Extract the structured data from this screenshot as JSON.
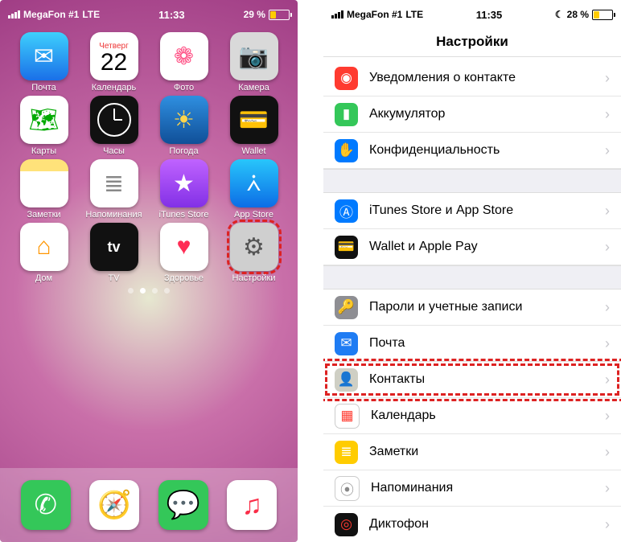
{
  "left": {
    "status": {
      "carrier": "MegaFon #1",
      "net": "LTE",
      "time": "11:33",
      "battery": "29 %",
      "battery_pct": 29,
      "fill": "#ffcc00"
    },
    "apps": [
      [
        {
          "n": "mail",
          "label": "Почта",
          "bg": "linear-gradient(#3ed0fd,#1a6fe8)",
          "glyph": "✉︎",
          "gc": "#fff"
        },
        {
          "n": "calendar",
          "label": "Календарь",
          "day": "Четверг",
          "date": "22"
        },
        {
          "n": "photos",
          "label": "Фото",
          "bg": "#fff",
          "glyph": "❁",
          "gc": "#f58"
        },
        {
          "n": "camera",
          "label": "Камера",
          "bg": "#d9d9d9",
          "glyph": "📷",
          "gc": "#333"
        }
      ],
      [
        {
          "n": "maps",
          "label": "Карты",
          "bg": "#fff",
          "glyph": "🗺",
          "gc": "#0a0"
        },
        {
          "n": "clock",
          "label": "Часы"
        },
        {
          "n": "weather",
          "label": "Погода",
          "bg": "linear-gradient(#2f8fe0,#104f98)",
          "glyph": "☀︎",
          "gc": "#ffd54a"
        },
        {
          "n": "wallet",
          "label": "Wallet",
          "bg": "#111",
          "glyph": "💳",
          "gc": "#fff"
        }
      ],
      [
        {
          "n": "notes",
          "label": "Заметки",
          "bg": "linear-gradient(#ffe27a 0 25%,#fff 25%)",
          "glyph": "",
          "gc": "#888"
        },
        {
          "n": "reminders",
          "label": "Напоминания",
          "bg": "#fff",
          "glyph": "≣",
          "gc": "#888"
        },
        {
          "n": "itunes",
          "label": "iTunes Store",
          "bg": "linear-gradient(#c063ff,#8230e6)",
          "glyph": "★",
          "gc": "#fff"
        },
        {
          "n": "appstore",
          "label": "App Store",
          "bg": "linear-gradient(#28c6fb,#0c6de6)",
          "glyph": "⩑",
          "gc": "#fff"
        }
      ],
      [
        {
          "n": "home",
          "label": "Дом",
          "bg": "#fff",
          "glyph": "⌂",
          "gc": "#ff9500"
        },
        {
          "n": "tv",
          "label": "TV",
          "bg": "#111",
          "glyph": "tv",
          "gc": "#fff",
          "fs": "18px",
          "fw": "600"
        },
        {
          "n": "health",
          "label": "Здоровье",
          "bg": "#fff",
          "glyph": "♥",
          "gc": "#ff2d55"
        },
        {
          "n": "settings",
          "label": "Настройки",
          "bg": "#cfcfcf",
          "glyph": "⚙︎",
          "gc": "#555",
          "hl": true
        }
      ]
    ],
    "dock": [
      {
        "n": "phone",
        "bg": "#34c759",
        "glyph": "✆",
        "gc": "#fff"
      },
      {
        "n": "safari",
        "bg": "#fff",
        "glyph": "🧭",
        "gc": "#006"
      },
      {
        "n": "messages",
        "bg": "#34c759",
        "glyph": "💬",
        "gc": "#fff"
      },
      {
        "n": "music",
        "bg": "#fff",
        "glyph": "♫",
        "gc": "#fa2d48"
      }
    ],
    "pages": {
      "count": 4,
      "active": 1
    }
  },
  "right": {
    "status": {
      "carrier": "MegaFon #1",
      "net": "LTE",
      "time": "11:35",
      "battery": "28 %",
      "battery_pct": 28,
      "moon": "☾",
      "fill": "#ffcc00"
    },
    "title": "Настройки",
    "groups": [
      [
        {
          "n": "notifications-contact",
          "label": "Уведомления о контакте",
          "bg": "#ff3b30",
          "glyph": "◉"
        },
        {
          "n": "battery",
          "label": "Аккумулятор",
          "bg": "#34c759",
          "glyph": "▮"
        },
        {
          "n": "privacy",
          "label": "Конфиденциальность",
          "bg": "#007aff",
          "glyph": "✋"
        }
      ],
      [
        {
          "n": "itunes-appstore",
          "label": "iTunes Store и App Store",
          "bg": "#007aff",
          "glyph": "Ⓐ"
        },
        {
          "n": "wallet-pay",
          "label": "Wallet и Apple Pay",
          "bg": "#111",
          "glyph": "💳"
        }
      ],
      [
        {
          "n": "passwords",
          "label": "Пароли и учетные записи",
          "bg": "#8e8e93",
          "glyph": "🔑"
        },
        {
          "n": "mail",
          "label": "Почта",
          "bg": "#1f7cf3",
          "glyph": "✉︎"
        },
        {
          "n": "contacts",
          "label": "Контакты",
          "bg": "#cfcfc4",
          "glyph": "👤",
          "hl": true
        },
        {
          "n": "calendar",
          "label": "Календарь",
          "bg": "#fff",
          "glyph": "▦",
          "gc": "#ff3b30",
          "border": true
        },
        {
          "n": "notes",
          "label": "Заметки",
          "bg": "#ffcc00",
          "glyph": "≣",
          "gc": "#fff"
        },
        {
          "n": "reminders",
          "label": "Напоминания",
          "bg": "#fff",
          "glyph": "⦿",
          "gc": "#888",
          "border": true
        },
        {
          "n": "voice-memos",
          "label": "Диктофон",
          "bg": "#111",
          "glyph": "◎",
          "gc": "#ff3b30"
        }
      ]
    ]
  }
}
